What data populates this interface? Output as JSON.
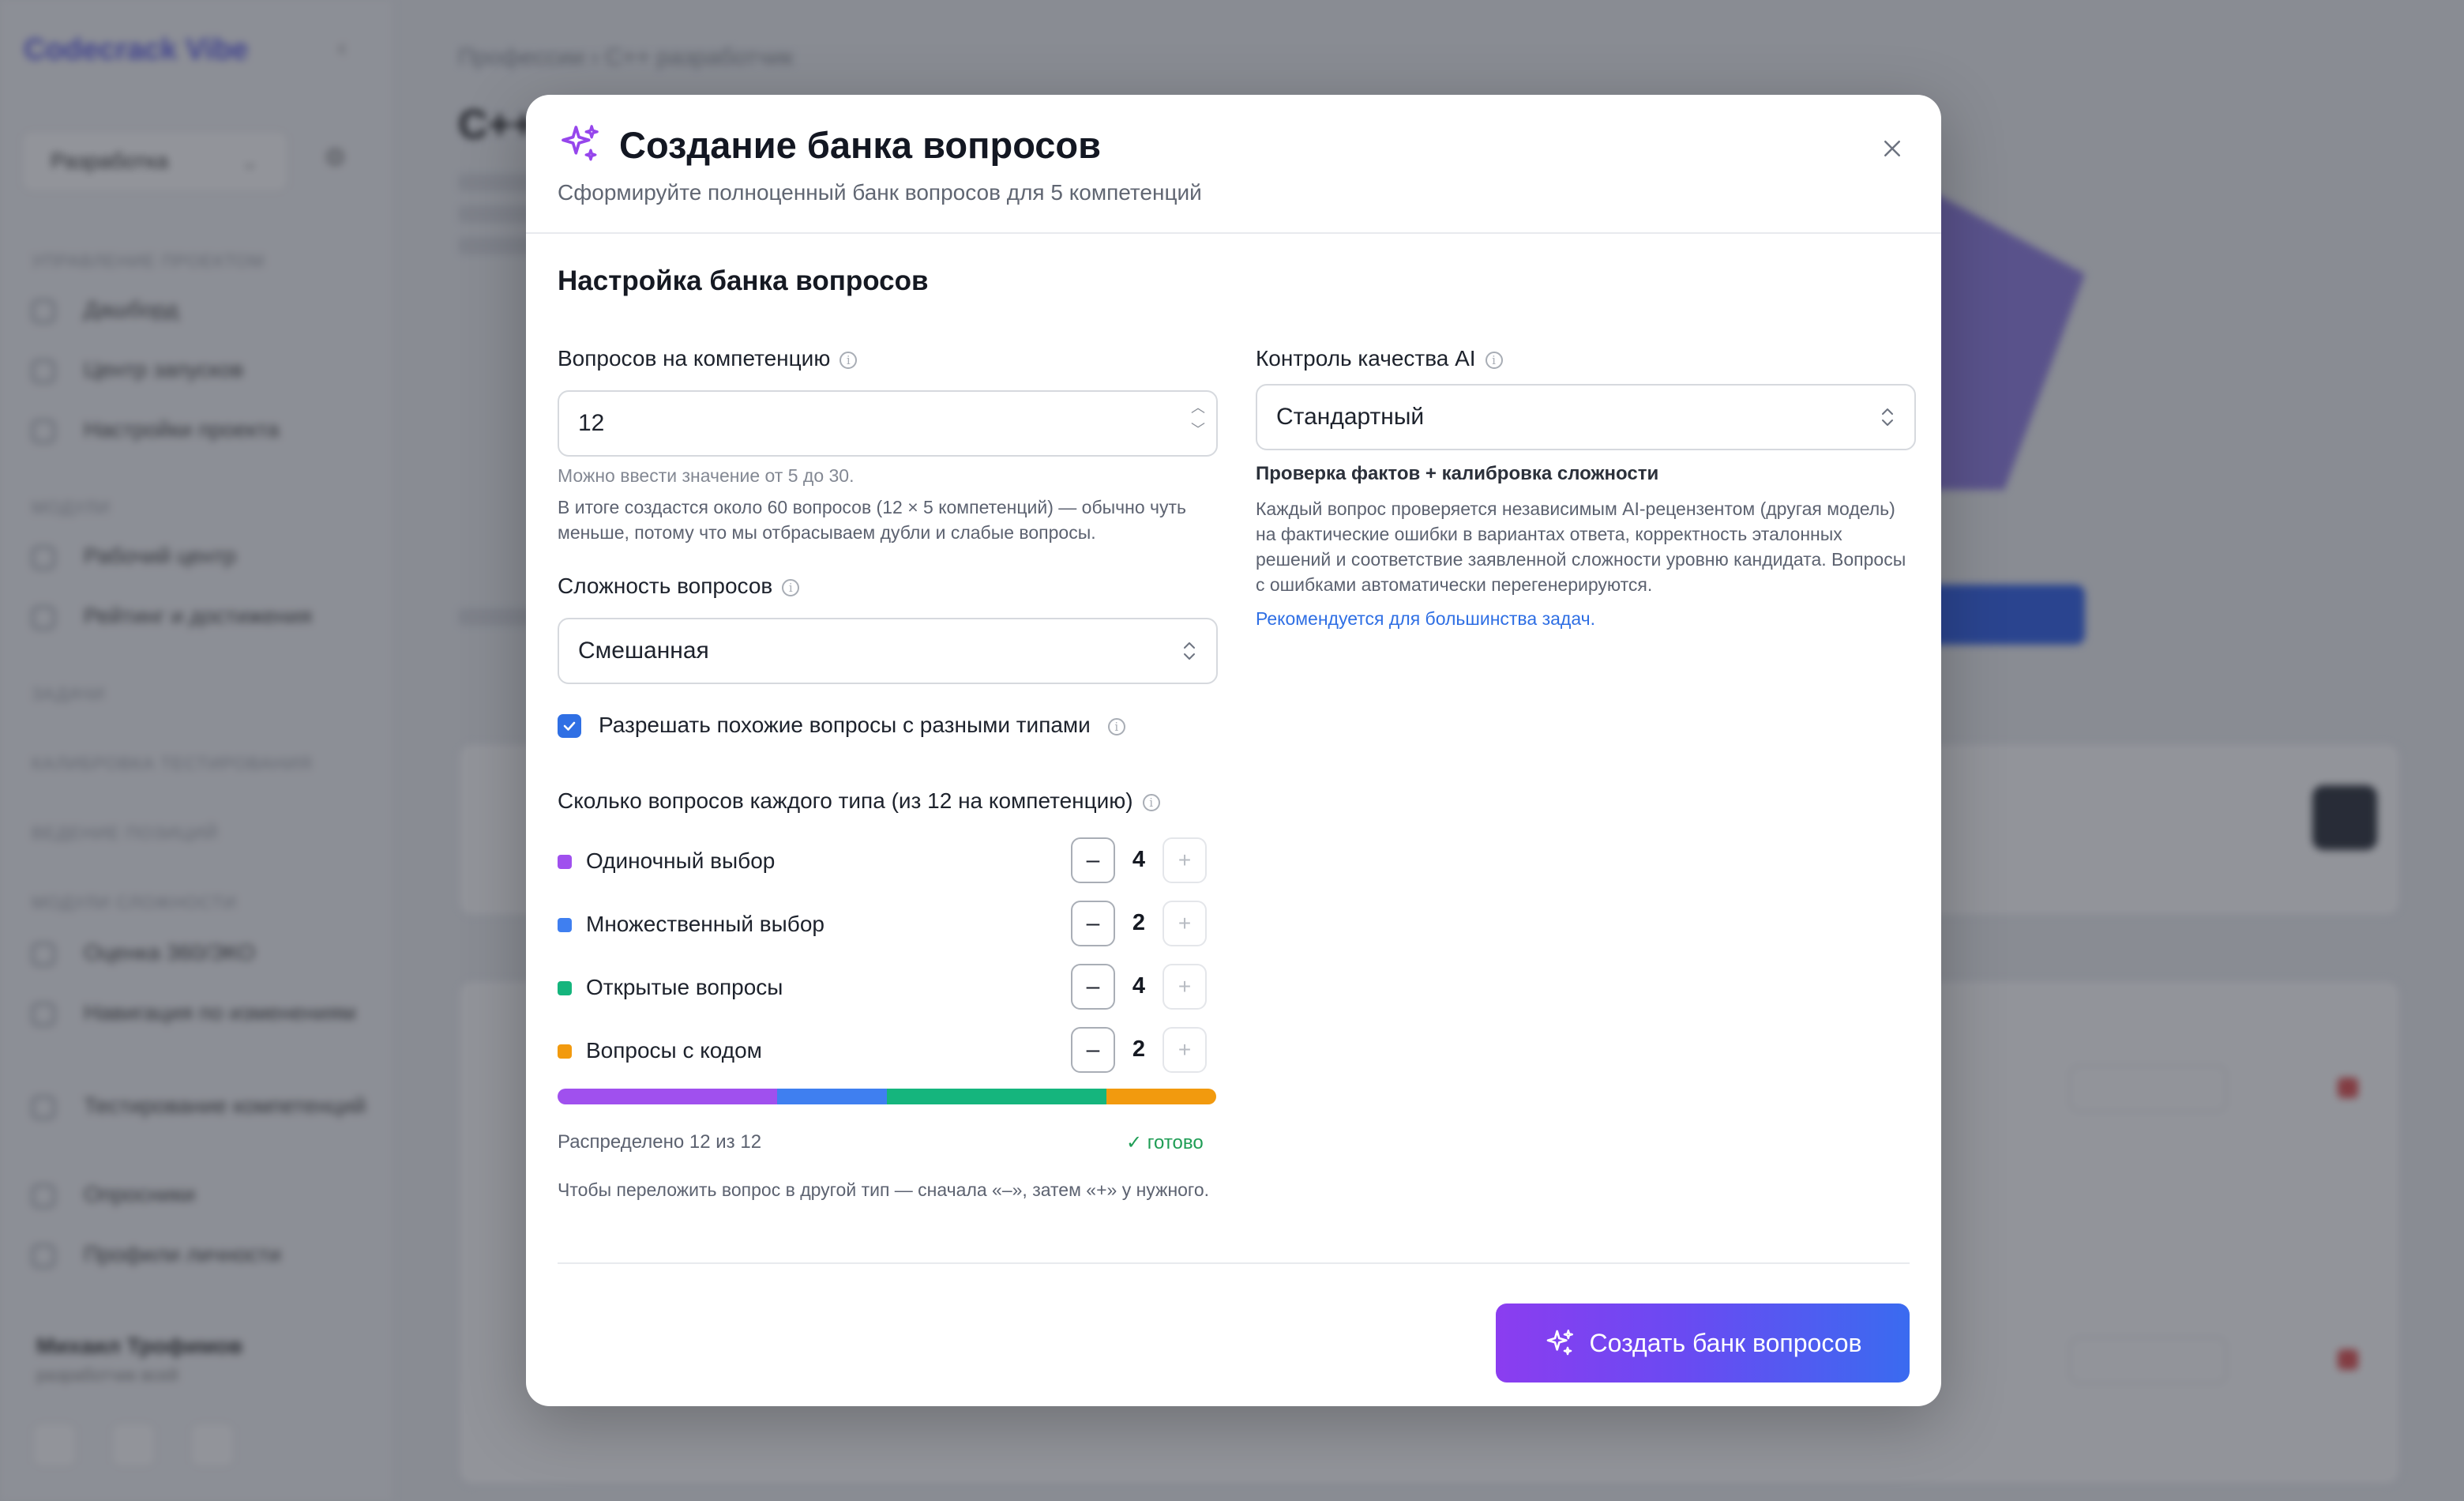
{
  "background": {
    "brand": "Codecrack Vibe",
    "workspace": "Разработка",
    "sidebar_sections": [
      "УПРАВЛЕНИЕ ПРОЕКТОМ",
      "МОДУЛИ",
      "ЗАДАЧИ",
      "КАЛИБРОВКА ТЕСТИРОВАНИЯ",
      "ВЕДЕНИЕ ПОЗИЦИЙ",
      "МОДУЛИ СЛОЖНОСТИ"
    ],
    "sidebar_items": [
      "Дашборд",
      "Центр запусков",
      "Настройки проекта",
      "Рабочий центр",
      "Рейтинг и достижения",
      "Оценка 360/ЭКО",
      "Навигация по изменениям",
      "Тестирование компетенций",
      "Опросники",
      "Профили личности"
    ],
    "user_name": "Михаил Трофимов",
    "user_role": "разработчик всей",
    "breadcrumb": "Профессии  ›  C++ разработчик",
    "page_title": "C++"
  },
  "modal": {
    "title": "Создание банка вопросов",
    "subtitle": "Сформируйте полноценный банк вопросов для 5 компетенций",
    "section_title": "Настройка банка вопросов",
    "questions_per_competency": {
      "label": "Вопросов на компетенцию",
      "value": "12",
      "range_hint": "Можно ввести значение от 5 до 30.",
      "total_hint": "В итоге создастся около 60 вопросов (12 × 5 компетенций) — обычно чуть меньше, потому что мы отбрасываем дубли и слабые вопросы."
    },
    "difficulty": {
      "label": "Сложность вопросов",
      "value": "Смешанная"
    },
    "allow_similar": {
      "label": "Разрешать похожие вопросы с разными типами",
      "checked": true
    },
    "types": {
      "label": "Сколько вопросов каждого типа (из 12 на компетенцию)",
      "items": [
        {
          "label": "Одиночный выбор",
          "count": "4",
          "color": "#a050ee"
        },
        {
          "label": "Множественный выбор",
          "count": "2",
          "color": "#3f7ff0"
        },
        {
          "label": "Открытые вопросы",
          "count": "4",
          "color": "#15b57d"
        },
        {
          "label": "Вопросы с кодом",
          "count": "2",
          "color": "#f29a0e"
        }
      ],
      "distribution": [
        4,
        2,
        4,
        2
      ],
      "distributed_label": "Распределено 12 из 12",
      "done_label": "✓ готово",
      "hint": "Чтобы переложить вопрос в другой тип — сначала «–», затем «+» у нужного."
    },
    "quality": {
      "label": "Контроль качества AI",
      "value": "Стандартный",
      "title": "Проверка фактов + калибровка сложности",
      "description": "Каждый вопрос проверяется независимым AI-рецензентом (другая модель) на фактические ошибки в вариантах ответа, корректность эталонных решений и соответствие заявленной сложности уровню кандидата. Вопросы с ошибками автоматически перегенерируются.",
      "recommendation": "Рекомендуется для большинства задач."
    },
    "submit_label": "Создать банк вопросов",
    "accent_gradient": [
      "#8b3df0",
      "#3a6bf0"
    ]
  }
}
